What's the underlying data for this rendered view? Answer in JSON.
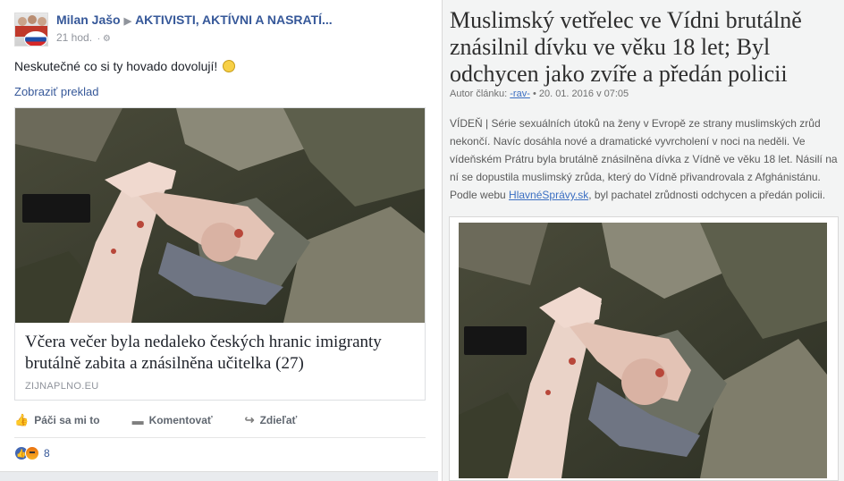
{
  "fb_post": {
    "author": "Milan Jašo",
    "group": "AKTIVISTI, AKTÍVNI A NASRATÍ...",
    "time": "21 hod.",
    "text": "Neskutečné co si ty hovado dovolují!",
    "translate": "Zobraziť preklad",
    "link_card": {
      "title": "Včera večer byla nedaleko českých hranic imigranty brutálně zabita a znásilněna učitelka (27)",
      "domain": "ZIJNAPLNO.EU"
    },
    "actions": {
      "like": "Páči sa mi to",
      "comment": "Komentovať",
      "share": "Zdieľať"
    },
    "reactions_count": "8"
  },
  "article": {
    "title": "Muslimský vetřelec ve Vídni brutálně znásilnil dívku ve věku 18 let; Byl odchycen jako zvíře a předán policii",
    "meta_prefix": "Autor článku:",
    "author": "-rav-",
    "meta_suffix": "• 20. 01. 2016 v 07:05",
    "body_pre": "VÍDEŇ | Série sexuálních útoků na ženy v Evropě ze strany muslimských zrůd nekončí. Navíc dosáhla nové a dramatické vyvrcholení v noci na neděli. Ve vídeňském Prátru byla brutálně znásilněna dívka z Vídně ve věku 18 let. Násilí na ní se dopustila muslimský zrůda, který do Vídně přivandrovala z Afghánistánu. Podle webu ",
    "body_link": "HlavnéSprávy.sk",
    "body_post": ", byl pachatel zrůdnosti odchycen a předán policii."
  },
  "colors": {
    "fb_link": "#365899",
    "fb_gray": "#90949c",
    "article_link": "#3b6fc2"
  },
  "icons": [
    "globe-icon",
    "like-icon",
    "comment-icon",
    "share-icon",
    "like-reaction-icon",
    "angry-reaction-icon",
    "censor-bar"
  ]
}
